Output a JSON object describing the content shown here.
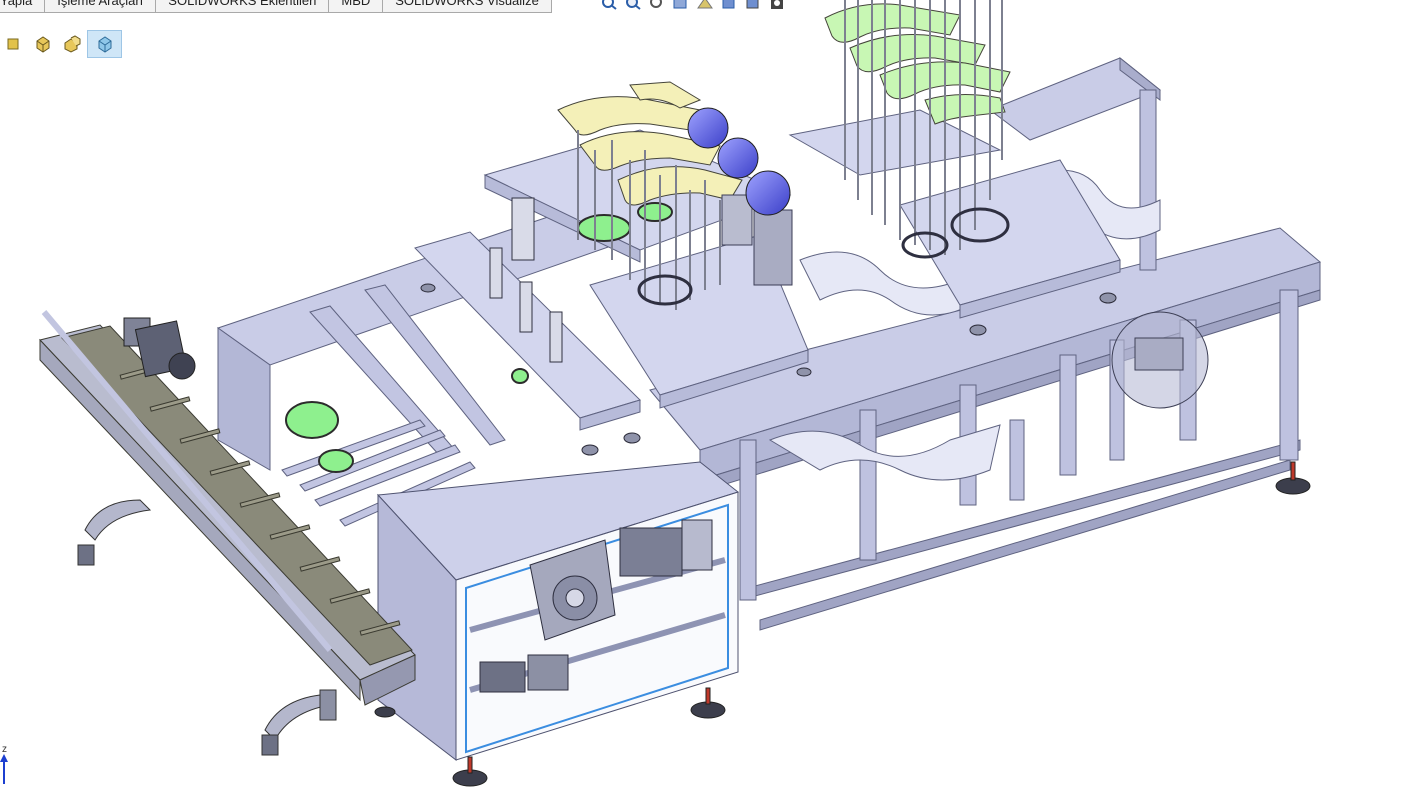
{
  "command_tabs": [
    {
      "label": "Yapla"
    },
    {
      "label": "İşleme Araçları"
    },
    {
      "label": "SOLIDWORKS Eklentileri"
    },
    {
      "label": "MBD"
    },
    {
      "label": "SOLIDWORKS Visualize"
    }
  ],
  "breadcrumb_icons": [
    "sketch-icon",
    "part-icon",
    "assembly-icon",
    "component-icon"
  ],
  "hud_icons": [
    "zoom-to-fit-icon",
    "zoom-area-icon",
    "previous-view-icon",
    "section-view-icon",
    "dynamic-annotation-icon",
    "view-orientation-icon",
    "display-style-icon",
    "hide-show-icon"
  ],
  "triad": {
    "axis_label": "z"
  },
  "colors": {
    "frame": "#c7cbe6",
    "frame_dark": "#8e93b3",
    "highlight_green": "#7df07d",
    "gripper_yellow": "#f4f0b8",
    "gripper_green": "#c8f7b4",
    "sphere_blue": "#5a5ee0",
    "conveyor_chain": "#8a8a7a",
    "motor_gray": "#707480"
  }
}
